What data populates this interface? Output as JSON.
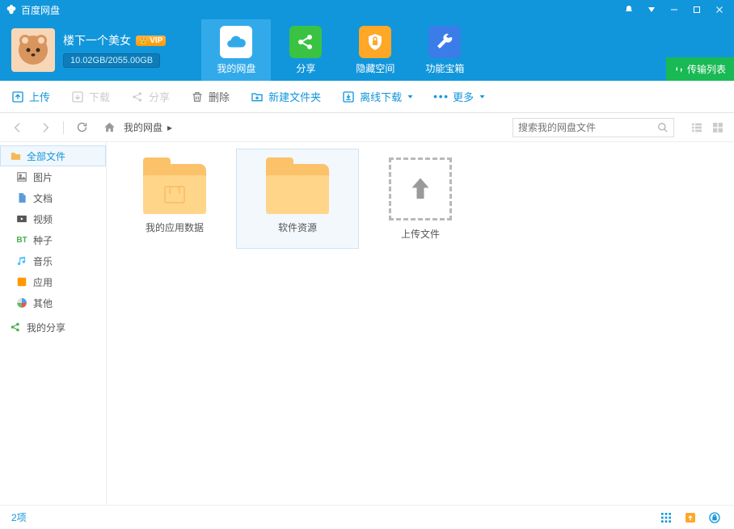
{
  "app": {
    "title": "百度网盘"
  },
  "user": {
    "name": "楼下一个美女",
    "vip": "VIP",
    "quota": "10.02GB/2055.00GB"
  },
  "tabs": [
    {
      "label": "我的网盘"
    },
    {
      "label": "分享"
    },
    {
      "label": "隐藏空间"
    },
    {
      "label": "功能宝箱"
    }
  ],
  "transfer_button": "传输列表",
  "toolbar": {
    "upload": "上传",
    "download": "下载",
    "share": "分享",
    "delete": "删除",
    "newfolder": "新建文件夹",
    "offline": "离线下载",
    "more": "更多"
  },
  "breadcrumb": {
    "root": "我的网盘"
  },
  "search": {
    "placeholder": "搜索我的网盘文件"
  },
  "sidebar": {
    "items": [
      {
        "label": "全部文件",
        "icon": "folder"
      },
      {
        "label": "图片",
        "icon": "image"
      },
      {
        "label": "文档",
        "icon": "doc"
      },
      {
        "label": "视频",
        "icon": "video"
      },
      {
        "label": "种子",
        "icon": "bt"
      },
      {
        "label": "音乐",
        "icon": "music"
      },
      {
        "label": "应用",
        "icon": "app"
      },
      {
        "label": "其他",
        "icon": "other"
      }
    ],
    "my_share": "我的分享"
  },
  "files": [
    {
      "name": "我的应用数据",
      "type": "folder_app"
    },
    {
      "name": "软件资源",
      "type": "folder"
    }
  ],
  "upload_tile": "上传文件",
  "status": {
    "count": "2项"
  }
}
